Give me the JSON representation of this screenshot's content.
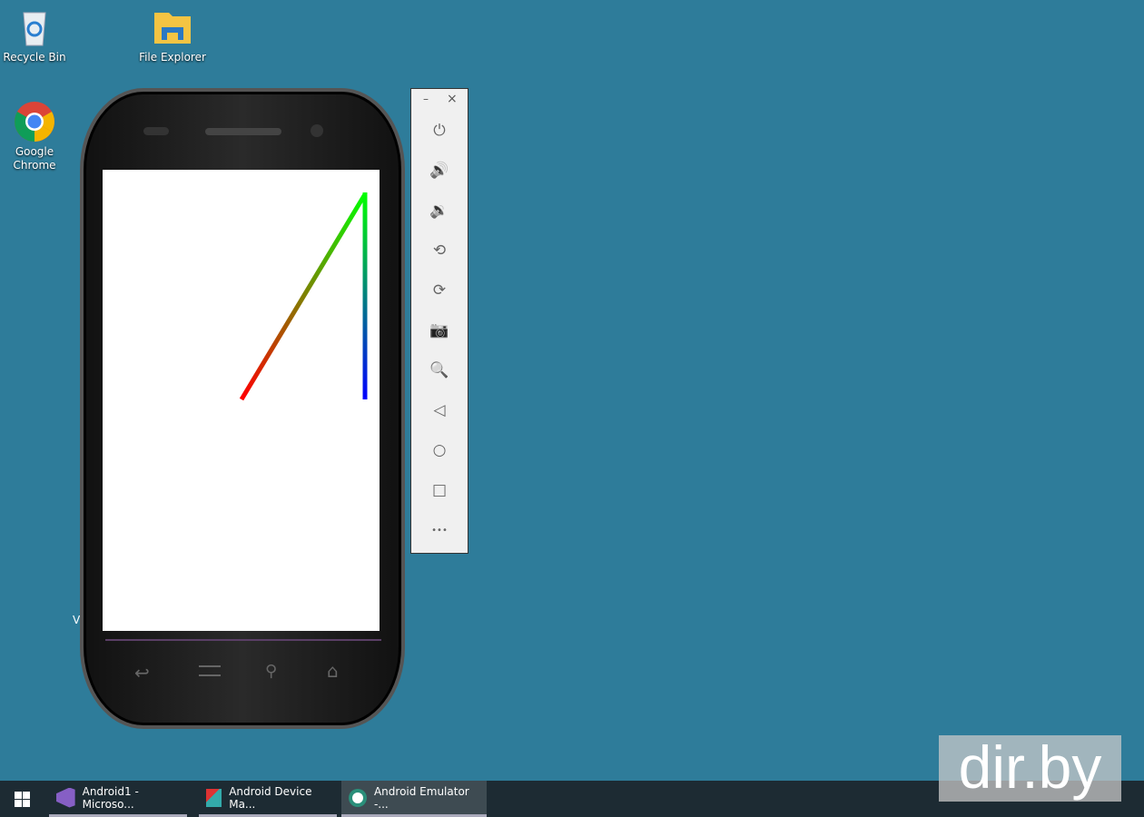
{
  "desktop": {
    "icons": [
      {
        "label": "Recycle Bin"
      },
      {
        "label": "File Explorer"
      },
      {
        "label": "Google Chrome"
      }
    ],
    "hidden_label": "V"
  },
  "emulator": {
    "panel": {
      "minimize": "–",
      "close": "×",
      "buttons": [
        "power",
        "volume-up",
        "volume-down",
        "rotate-left",
        "rotate-right",
        "screenshot",
        "zoom",
        "back",
        "home",
        "overview",
        "more"
      ]
    },
    "drawing": {
      "colors": {
        "start": "#ff0000",
        "top": "#00ff00",
        "end": "#0000ff"
      }
    }
  },
  "taskbar": {
    "items": [
      {
        "label": "Android1 - Microso..."
      },
      {
        "label": "Android Device Ma..."
      },
      {
        "label": "Android Emulator -..."
      }
    ]
  },
  "watermark": "dir.by"
}
